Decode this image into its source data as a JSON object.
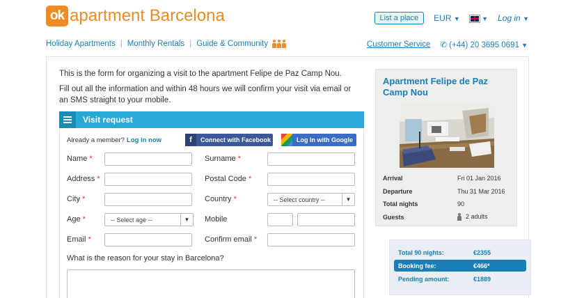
{
  "header": {
    "logo_badge": "ok",
    "logo_text": "apartment Barcelona",
    "list_place": "List a place",
    "currency": "EUR",
    "login": "Log in"
  },
  "nav": {
    "items": [
      "Holiday Apartments",
      "Monthly Rentals",
      "Guide & Community"
    ],
    "customer_service": "Customer Service",
    "phone": "(+44) 20 3695 0691"
  },
  "intro": {
    "line1": "This is the form for organizing a visit to the apartment Felipe de Paz Camp Nou.",
    "line2": "Fill out all the information and within 48 hours we will confirm your visit via email or an SMS straight to your mobile."
  },
  "visit_request": {
    "title": "Visit request",
    "member_text": "Already a member?",
    "login_now": "Log in now",
    "facebook_btn": "Connect with Facebook",
    "google_btn": "Log In with Google",
    "labels": {
      "name": "Name",
      "surname": "Surname",
      "address": "Address",
      "postal_code": "Postal Code",
      "city": "City",
      "country": "Country",
      "age": "Age",
      "mobile": "Mobile",
      "email": "Email",
      "confirm_email": "Confirm email"
    },
    "required_mark": "*",
    "country_placeholder": "-- Select country --",
    "age_placeholder": "-- Select age --",
    "reason_question": "What is the reason for your stay in Barcelona?"
  },
  "apartment": {
    "title": "Apartment Felipe de Paz Camp Nou",
    "details": [
      {
        "label": "Arrival",
        "value": "Fri 01 Jan 2016"
      },
      {
        "label": "Departure",
        "value": "Thu 31 Mar 2016"
      },
      {
        "label": "Total nights",
        "value": "90"
      },
      {
        "label": "Guests",
        "value": "2 adults"
      }
    ]
  },
  "pricing": {
    "rows": [
      {
        "label": "Total 90 nights:",
        "value": "€2355"
      },
      {
        "label": "Booking fee:",
        "value": "€466*"
      },
      {
        "label": "Pending amount:",
        "value": "€1889"
      }
    ]
  },
  "colors": {
    "brand_orange": "#f08a24",
    "link_blue": "#1a7fb8",
    "header_blue": "#29a9d6"
  }
}
